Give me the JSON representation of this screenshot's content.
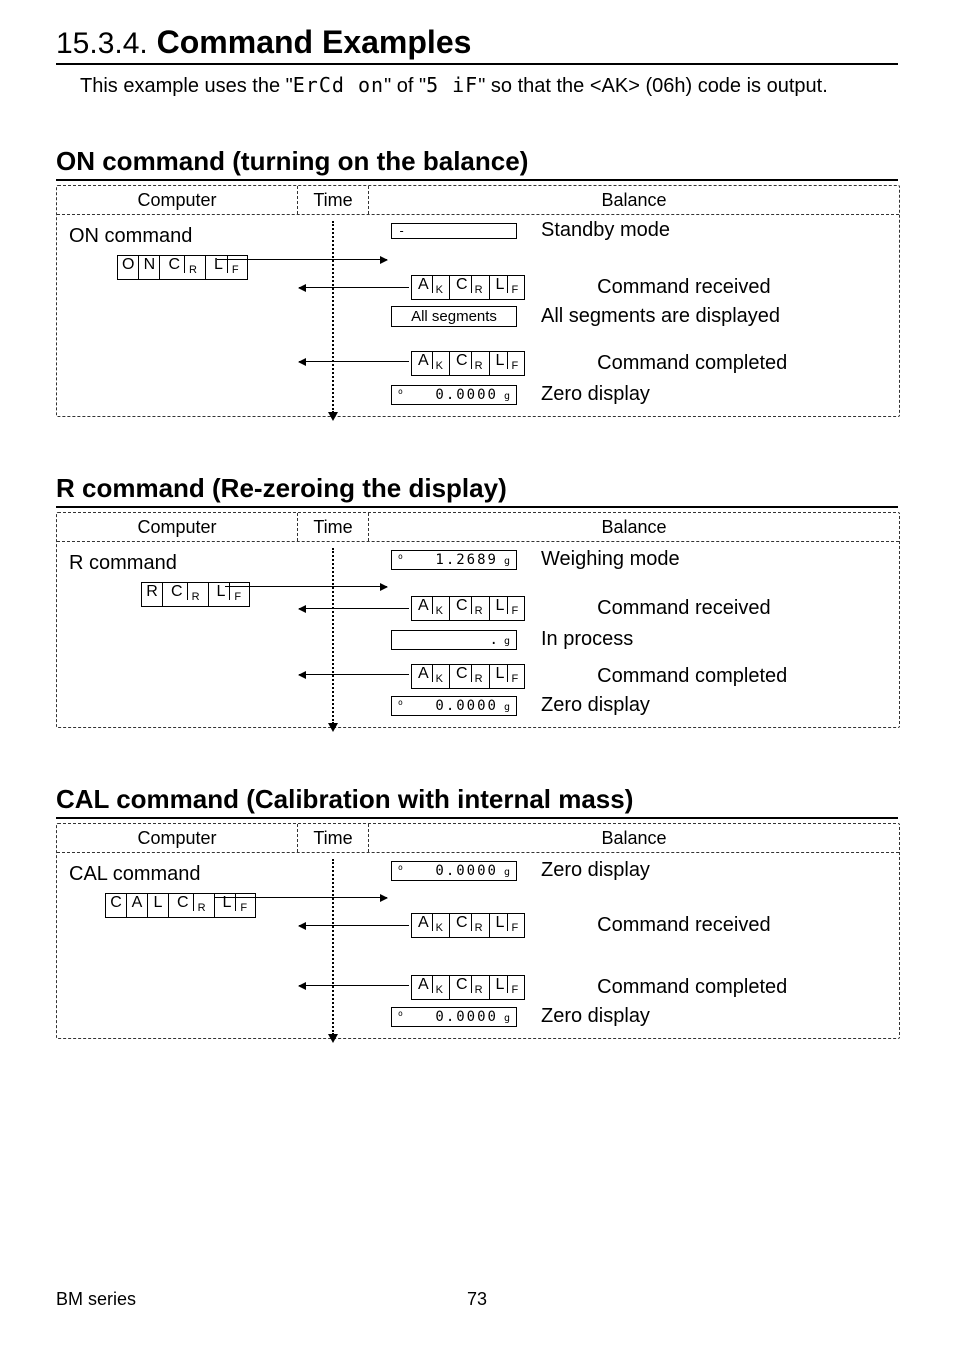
{
  "section": {
    "number": "15.3.4.",
    "title": "Command Examples"
  },
  "intro": {
    "p1": "This example uses the \"",
    "seg1": "ErCd on",
    "p2": "\" of \"",
    "seg2": "5 iF",
    "p3": "\" so that the <AK> (06h) code is output."
  },
  "columns": {
    "computer": "Computer",
    "time": "Time",
    "balance": "Balance"
  },
  "ack": {
    "a": "A",
    "k": "K",
    "c": "C",
    "r": "R",
    "l": "L",
    "f": "F"
  },
  "zero_digits": "0.0000",
  "unit_g": "g",
  "on": {
    "heading": "ON command (turning on the balance)",
    "cmd_label": "ON command",
    "bytes": [
      "O",
      "N"
    ],
    "items": {
      "standby": "Standby mode",
      "received": "Command received",
      "allseg_box": "All segments",
      "allseg_text": "All segments are displayed",
      "completed": "Command completed",
      "zero": "Zero display"
    },
    "dash": "-"
  },
  "r": {
    "heading": "R command (Re-zeroing the display)",
    "cmd_label": "R command",
    "bytes": [
      "R"
    ],
    "weigh_val": "1.2689",
    "items": {
      "weighing": "Weighing mode",
      "received": "Command received",
      "inprocess": "In process",
      "completed": "Command completed",
      "zero": "Zero display"
    }
  },
  "cal": {
    "heading": "CAL command (Calibration with internal mass)",
    "cmd_label": "CAL command",
    "bytes": [
      "C",
      "A",
      "L"
    ],
    "items": {
      "zero1": "Zero display",
      "received": "Command received",
      "completed": "Command completed",
      "zero2": "Zero display"
    }
  },
  "footer": {
    "series": "BM series",
    "page": "73"
  }
}
